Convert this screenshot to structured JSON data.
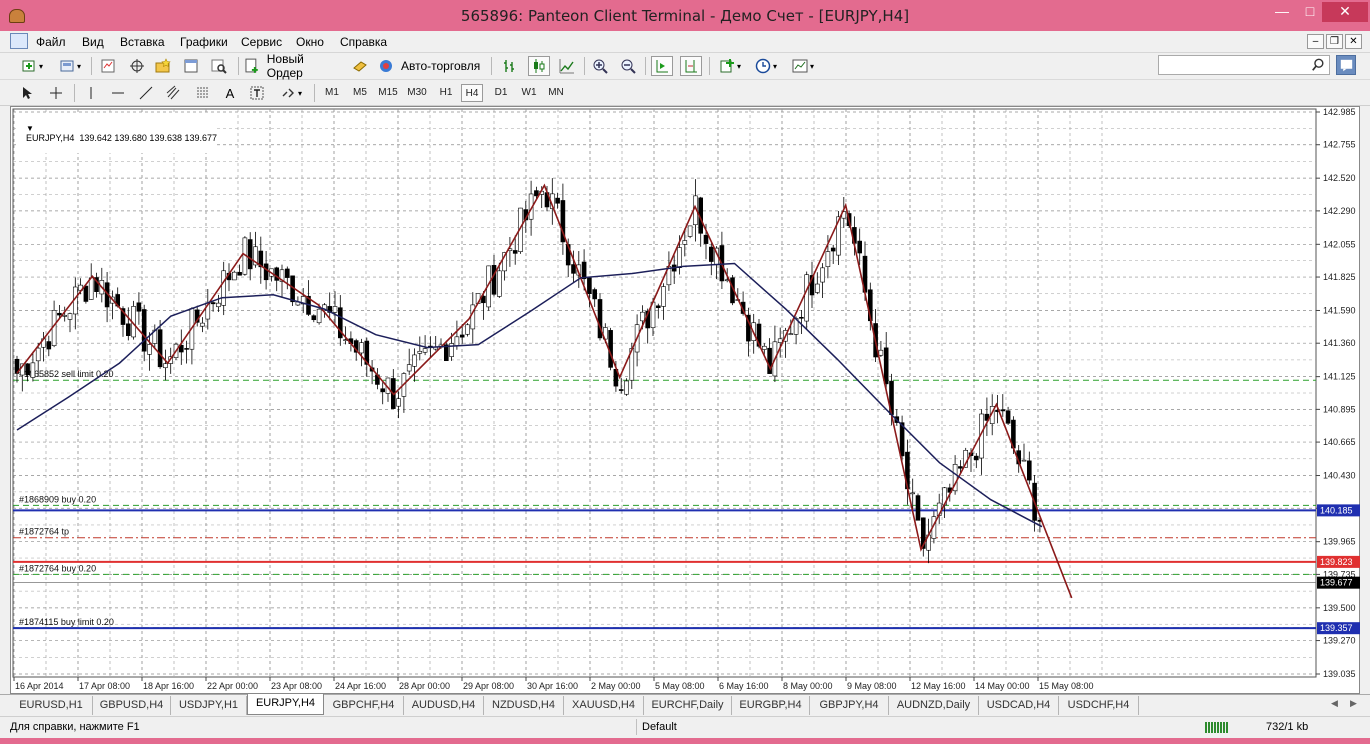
{
  "window": {
    "title": "565896: Panteon Client Terminal - Демо Счет - [EURJPY,H4]"
  },
  "menu": [
    "Файл",
    "Вид",
    "Вставка",
    "Графики",
    "Сервис",
    "Окно",
    "Справка"
  ],
  "toolbar": {
    "new_order": "Новый Ордер",
    "autotrade": "Авто-торговля"
  },
  "timeframes": [
    "M1",
    "M5",
    "M15",
    "M30",
    "H1",
    "H4",
    "D1",
    "W1",
    "MN"
  ],
  "active_timeframe": "H4",
  "drawing_tools": {
    "text": "A"
  },
  "chart": {
    "header": "EURJPY,H4  139.642 139.680 139.638 139.677",
    "price_scale": [
      "142.985",
      "142.755",
      "142.520",
      "142.290",
      "142.055",
      "141.825",
      "141.590",
      "141.360",
      "141.125",
      "140.895",
      "140.665",
      "140.430",
      "140.200",
      "139.965",
      "139.735",
      "139.500",
      "139.270",
      "139.035"
    ],
    "price_min": 139.035,
    "price_max": 142.985,
    "time_labels": [
      "16 Apr 2014",
      "17 Apr 08:00",
      "18 Apr 16:00",
      "22 Apr 00:00",
      "23 Apr 08:00",
      "24 Apr 16:00",
      "28 Apr 00:00",
      "29 Apr 08:00",
      "30 Apr 16:00",
      "2 May 00:00",
      "5 May 08:00",
      "6 May 16:00",
      "8 May 00:00",
      "9 May 08:00",
      "12 May 16:00",
      "14 May 00:00",
      "15 May 08:00"
    ],
    "order_lines": [
      {
        "label": "#1865852 sell limit 0.20",
        "price": 141.1,
        "color": "#2ca02c",
        "style": "dashed"
      },
      {
        "label": "#1868909 buy 0.20",
        "price": 140.22,
        "color": "#2ca02c",
        "style": "dashed"
      },
      {
        "label": "#1872764 tp",
        "price": 139.993,
        "color": "#c0392b",
        "style": "dashdot"
      },
      {
        "label": "#1872764 buy 0.20",
        "price": 139.735,
        "color": "#2ca02c",
        "style": "dashed"
      },
      {
        "label": "#1874115 buy limit 0.20",
        "price": 139.36,
        "color": "#2ca02c",
        "style": "dashed"
      }
    ],
    "h_lines": [
      {
        "price": 140.185,
        "label": "140.185",
        "color": "#1f2fb0"
      },
      {
        "price": 139.823,
        "label": "139.823",
        "color": "#e03030"
      },
      {
        "price": 139.357,
        "label": "139.357",
        "color": "#1f2fb0"
      }
    ],
    "bid": {
      "price": 139.677,
      "label": "139.677"
    }
  },
  "chart_data": {
    "type": "candlestick",
    "symbol": "EURJPY",
    "timeframe": "H4",
    "zigzag": [
      141.15,
      141.83,
      141.22,
      141.99,
      141.63,
      141.0,
      141.53,
      142.47,
      141.12,
      142.32,
      141.18,
      142.33,
      139.91,
      140.93,
      139.57
    ],
    "moving_average": [
      140.75,
      140.98,
      141.22,
      141.55,
      141.68,
      141.7,
      141.6,
      141.42,
      141.33,
      141.35,
      141.58,
      141.82,
      141.85,
      141.9,
      141.92,
      141.6,
      141.25,
      140.88,
      140.52,
      140.26,
      140.07
    ]
  },
  "tabs": [
    "EURUSD,H1",
    "GBPUSD,H4",
    "USDJPY,H1",
    "EURJPY,H4",
    "GBPCHF,H4",
    "AUDUSD,H4",
    "NZDUSD,H4",
    "XAUUSD,H4",
    "EURCHF,Daily",
    "EURGBP,H4",
    "GBPJPY,H4",
    "AUDNZD,Daily",
    "USDCAD,H4",
    "USDCHF,H4"
  ],
  "active_tab": "EURJPY,H4",
  "status": {
    "help": "Для справки, нажмите F1",
    "profile": "Default",
    "traffic": "732/1 kb"
  },
  "colors": {
    "titlebar": "#e36b8f",
    "candle_bull": "#ffffff",
    "candle_bear": "#000000",
    "zigzag": "#8b1a1a",
    "ma": "#1c1f5a",
    "grid": "#6e6e6e"
  }
}
